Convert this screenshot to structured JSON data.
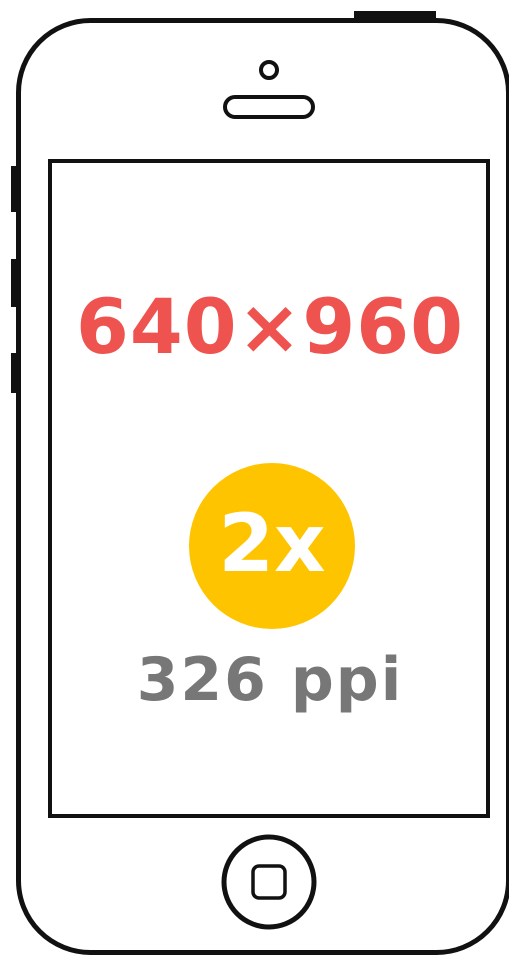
{
  "screen": {
    "resolution": "640×960",
    "scale": "2x",
    "density": "326 ppi"
  },
  "colors": {
    "resolution_text": "#ef5350",
    "badge_fill": "#ffc400",
    "density_text": "#777777",
    "outline": "#111111"
  }
}
